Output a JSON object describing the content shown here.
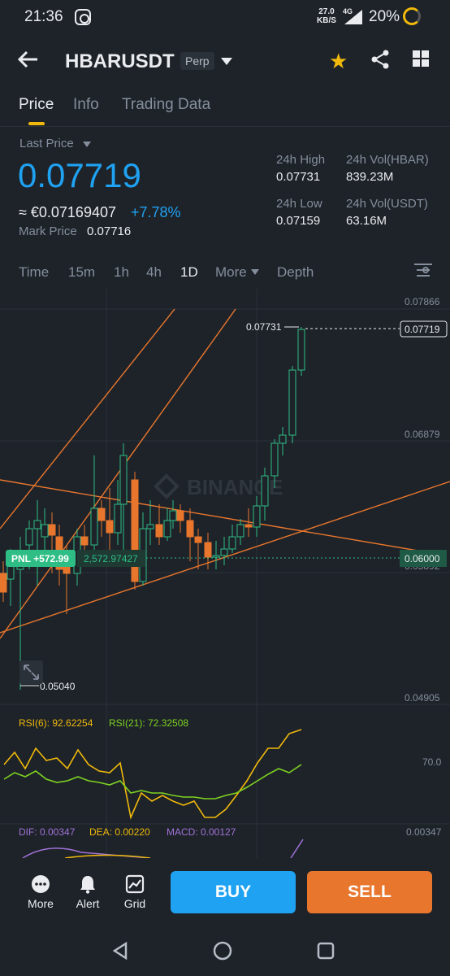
{
  "status_bar": {
    "time": "21:36",
    "net_speed": "27.0",
    "net_unit": "KB/S",
    "network": "4G",
    "battery": "20%"
  },
  "header": {
    "symbol": "HBARUSDT",
    "badge": "Perp"
  },
  "tabs": [
    {
      "label": "Price",
      "active": true
    },
    {
      "label": "Info",
      "active": false
    },
    {
      "label": "Trading Data",
      "active": false
    }
  ],
  "price": {
    "last_price_label": "Last Price",
    "last_price": "0.07719",
    "eur_price": "≈ €0.07169407",
    "change_pct": "+7.78%",
    "mark_price_label": "Mark Price",
    "mark_price": "0.07716"
  },
  "stats": {
    "high_label": "24h High",
    "high": "0.07731",
    "vol_hbar_label": "24h Vol(HBAR)",
    "vol_hbar": "839.23M",
    "low_label": "24h Low",
    "low": "0.07159",
    "vol_usdt_label": "24h Vol(USDT)",
    "vol_usdt": "63.16M"
  },
  "intervals": [
    {
      "label": "Time",
      "active": false
    },
    {
      "label": "15m",
      "active": false
    },
    {
      "label": "1h",
      "active": false
    },
    {
      "label": "4h",
      "active": false
    },
    {
      "label": "1D",
      "active": true
    },
    {
      "label": "More",
      "active": false
    },
    {
      "label": "Depth",
      "active": false
    }
  ],
  "chart_data": {
    "type": "candlestick",
    "y_axis_labels": [
      "0.07866",
      "0.06879",
      "0.05892",
      "0.04905"
    ],
    "current_price_tag": "0.07719",
    "high_marker": "0.07731",
    "low_marker": "0.05040",
    "pnl_label": "PNL +572.99",
    "position_price_text": "2,572.97427",
    "position_price_tag": "0.06000",
    "watermark": "BINANCE",
    "rsi": {
      "rsi6_label": "RSI(6): 92.62254",
      "rsi21_label": "RSI(21): 72.32508",
      "level": "70.0"
    },
    "macd": {
      "dif_label": "DIF: 0.00347",
      "dea_label": "DEA: 0.00220",
      "macd_label": "MACD: 0.00127",
      "axis": "0.00347"
    },
    "colors": {
      "up": "#2ebd85",
      "down": "#e8762d",
      "rsi6": "#f0b90b",
      "rsi21": "#7ed321",
      "dif": "#a072d8"
    }
  },
  "bottom_bar": {
    "more_label": "More",
    "alert_label": "Alert",
    "grid_label": "Grid",
    "buy_label": "BUY",
    "sell_label": "SELL"
  }
}
